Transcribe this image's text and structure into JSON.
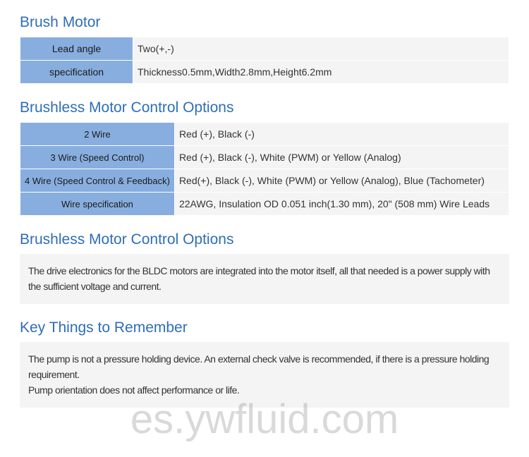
{
  "brush_motor": {
    "title": "Brush Motor",
    "rows": [
      {
        "label": "Lead angle",
        "value": "Two(+,-)"
      },
      {
        "label": "specification",
        "value": "Thickness0.5mm,Width2.8mm,Height6.2mm"
      }
    ]
  },
  "brushless_options_table": {
    "title": "Brushless Motor Control Options",
    "rows": [
      {
        "label": "2 Wire",
        "value": "Red (+), Black (-)"
      },
      {
        "label": "3 Wire (Speed Control)",
        "value": "Red (+), Black (-), White (PWM) or Yellow (Analog)"
      },
      {
        "label": "4 Wire (Speed Control & Feedback)",
        "value": "Red(+), Black (-), White (PWM) or Yellow (Analog), Blue (Tachometer)"
      },
      {
        "label": "Wire specification",
        "value": "22AWG, Insulation OD 0.051 inch(1.30 mm), 20\" (508 mm) Wire Leads"
      }
    ]
  },
  "brushless_options_text": {
    "title": "Brushless Motor Control Options",
    "body": "The drive electronics for the BLDC motors are integrated into the motor itself, all that needed is a power supply with the sufficient voltage and current."
  },
  "key_things": {
    "title": "Key Things to Remember",
    "line1": "The pump is not a pressure holding device. An external check valve is recommended, if there is a pressure holding requirement.",
    "line2": "Pump orientation does not affect performance or life."
  },
  "watermark": "es.ywfluid.com"
}
